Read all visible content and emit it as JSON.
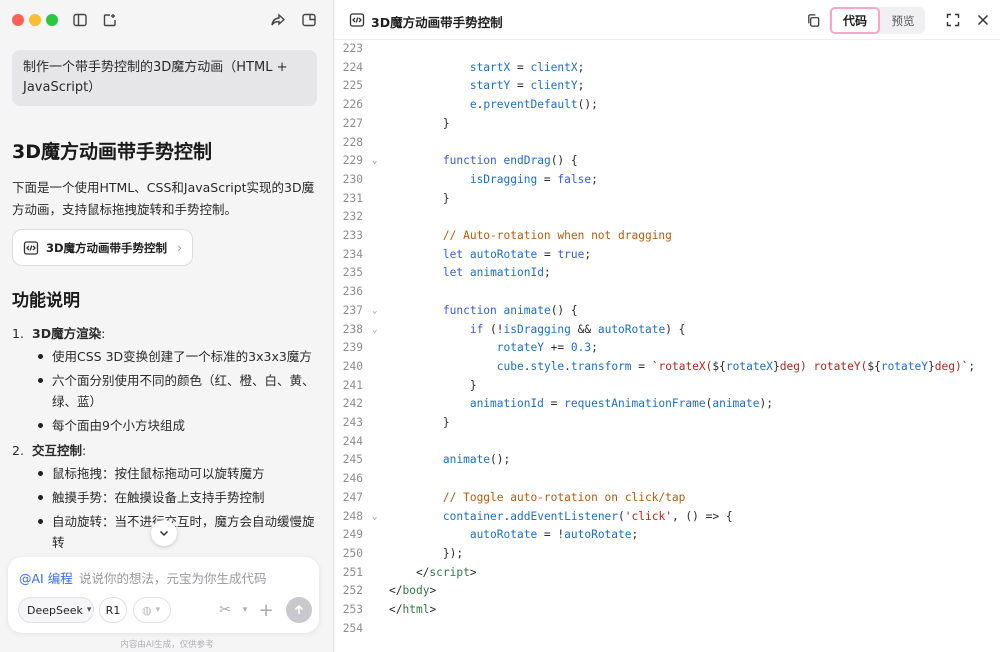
{
  "left": {
    "user_prompt": "制作一个带手势控制的3D魔方动画（HTML + JavaScript）",
    "heading": "3D魔方动画带手势控制",
    "intro": "下面是一个使用HTML、CSS和JavaScript实现的3D魔方动画，支持鼠标拖拽旋转和手势控制。",
    "card_label": "3D魔方动画带手势控制",
    "features_heading": "功能说明",
    "sections": [
      {
        "num": "1.",
        "title": "3D魔方渲染",
        "suffix": ":",
        "bullets": [
          "使用CSS 3D变换创建了一个标准的3x3x3魔方",
          "六个面分别使用不同的颜色（红、橙、白、黄、绿、蓝）",
          "每个面由9个小方块组成"
        ]
      },
      {
        "num": "2.",
        "title": "交互控制",
        "suffix": ":",
        "bullets": [
          "鼠标拖拽：按住鼠标拖动可以旋转魔方",
          "触摸手势：在触摸设备上支持手势控制",
          "自动旋转：当不进行交互时，魔方会自动缓慢旋转"
        ]
      }
    ],
    "composer": {
      "tag": "@AI 编程",
      "placeholder": "说说你的想法，元宝为你生成代码",
      "model": "DeepSeek",
      "mode": "R1"
    },
    "footnote": "内容由AI生成，仅供参考"
  },
  "right": {
    "title": "3D魔方动画带手势控制",
    "tab_code": "代码",
    "tab_preview": "预览",
    "lines": [
      {
        "n": "223",
        "fold": false,
        "html": ""
      },
      {
        "n": "224",
        "fold": false,
        "html": "            <span class=\"var\">startX</span> = <span class=\"var\">clientX</span>;"
      },
      {
        "n": "225",
        "fold": false,
        "html": "            <span class=\"var\">startY</span> = <span class=\"var\">clientY</span>;"
      },
      {
        "n": "226",
        "fold": false,
        "html": "            <span class=\"var\">e</span>.<span class=\"fn\">preventDefault</span>();"
      },
      {
        "n": "227",
        "fold": false,
        "html": "        }"
      },
      {
        "n": "228",
        "fold": false,
        "html": ""
      },
      {
        "n": "229",
        "fold": true,
        "html": "        <span class=\"kw\">function</span> <span class=\"fn\">endDrag</span>() {"
      },
      {
        "n": "230",
        "fold": false,
        "html": "            <span class=\"var\">isDragging</span> = <span class=\"kw\">false</span>;"
      },
      {
        "n": "231",
        "fold": false,
        "html": "        }"
      },
      {
        "n": "232",
        "fold": false,
        "html": ""
      },
      {
        "n": "233",
        "fold": false,
        "html": "        <span class=\"cm\">// Auto-rotation when not dragging</span>"
      },
      {
        "n": "234",
        "fold": false,
        "html": "        <span class=\"kw\">let</span> <span class=\"var\">autoRotate</span> = <span class=\"kw\">true</span>;"
      },
      {
        "n": "235",
        "fold": false,
        "html": "        <span class=\"kw\">let</span> <span class=\"var\">animationId</span>;"
      },
      {
        "n": "236",
        "fold": false,
        "html": ""
      },
      {
        "n": "237",
        "fold": true,
        "html": "        <span class=\"kw\">function</span> <span class=\"fn\">animate</span>() {"
      },
      {
        "n": "238",
        "fold": true,
        "html": "            <span class=\"kw\">if</span> (!<span class=\"var\">isDragging</span> &amp;&amp; <span class=\"var\">autoRotate</span>) {"
      },
      {
        "n": "239",
        "fold": false,
        "html": "                <span class=\"var\">rotateY</span> += <span class=\"num\">0.3</span>;"
      },
      {
        "n": "240",
        "fold": false,
        "html": "                <span class=\"var\">cube</span>.<span class=\"var\">style</span>.<span class=\"var\">transform</span> = <span class=\"str\">`rotateX(</span>${<span class=\"var\">rotateX</span>}<span class=\"str\">deg) rotateY(</span>${<span class=\"var\">rotateY</span>}<span class=\"str\">deg)`</span>;"
      },
      {
        "n": "241",
        "fold": false,
        "html": "            }"
      },
      {
        "n": "242",
        "fold": false,
        "html": "            <span class=\"var\">animationId</span> = <span class=\"fn\">requestAnimationFrame</span>(<span class=\"var\">animate</span>);"
      },
      {
        "n": "243",
        "fold": false,
        "html": "        }"
      },
      {
        "n": "244",
        "fold": false,
        "html": ""
      },
      {
        "n": "245",
        "fold": false,
        "html": "        <span class=\"fn\">animate</span>();"
      },
      {
        "n": "246",
        "fold": false,
        "html": ""
      },
      {
        "n": "247",
        "fold": false,
        "html": "        <span class=\"cm\">// Toggle auto-rotation on click/tap</span>"
      },
      {
        "n": "248",
        "fold": true,
        "html": "        <span class=\"var\">container</span>.<span class=\"fn\">addEventListener</span>(<span class=\"str\">'click'</span>, () =&gt; {"
      },
      {
        "n": "249",
        "fold": false,
        "html": "            <span class=\"var\">autoRotate</span> = !<span class=\"var\">autoRotate</span>;"
      },
      {
        "n": "250",
        "fold": false,
        "html": "        });"
      },
      {
        "n": "251",
        "fold": false,
        "html": "    &lt;/<span class=\"tag\">script</span>&gt;"
      },
      {
        "n": "252",
        "fold": false,
        "html": "&lt;/<span class=\"tag\">body</span>&gt;"
      },
      {
        "n": "253",
        "fold": false,
        "html": "&lt;/<span class=\"tag\">html</span>&gt;"
      },
      {
        "n": "254",
        "fold": false,
        "html": ""
      }
    ]
  }
}
